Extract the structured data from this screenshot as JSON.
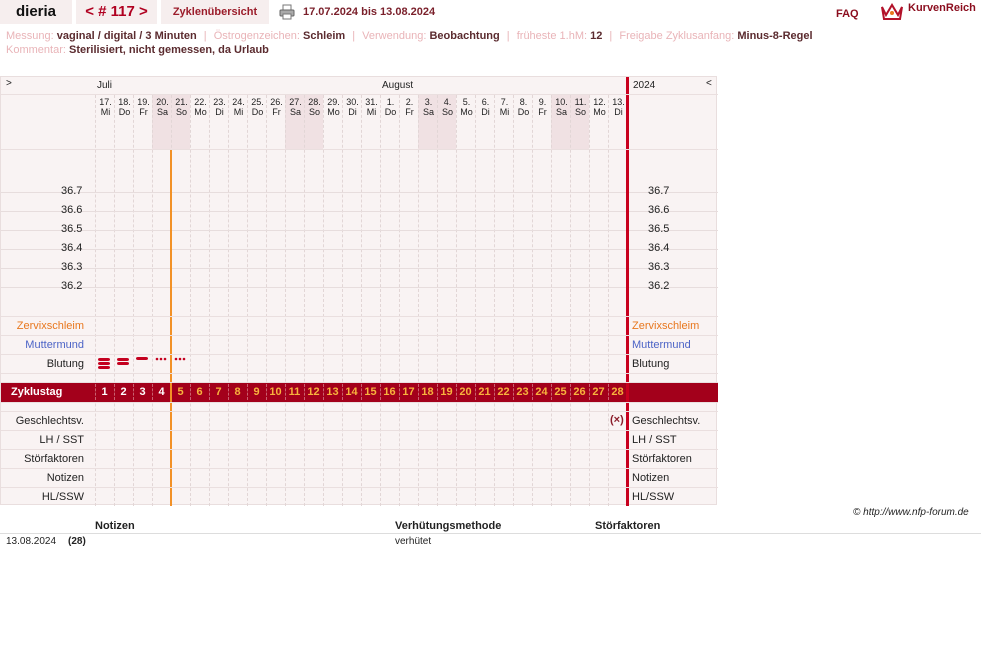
{
  "header": {
    "username": "dieria",
    "cycle_prev": "<",
    "cycle_label": "# 117",
    "cycle_next": ">",
    "overview_tab": "Zyklenübersicht",
    "print_icon": "printer-icon",
    "date_range": "17.07.2024 bis 13.08.2024",
    "faq": "FAQ",
    "logo_text": "KurvenReich",
    "logo_icon": "crown-icon"
  },
  "info": {
    "messung_label": "Messung:",
    "messung_value": "vaginal / digital / 3 Minuten",
    "oestrogen_label": "Östrogenzeichen:",
    "oestrogen_value": "Schleim",
    "verwendung_label": "Verwendung:",
    "verwendung_value": "Beobachtung",
    "hm_label": "früheste 1.hM:",
    "hm_value": "12",
    "freigabe_label": "Freigabe Zyklusanfang:",
    "freigabe_value": "Minus-8-Regel",
    "kommentar_label": "Kommentar:",
    "kommentar_value": "Sterilisiert, nicht gemessen, da Urlaub"
  },
  "chart": {
    "nav_left": ">",
    "nav_right": "<",
    "month_juli": "Juli",
    "month_august": "August",
    "year": "2024",
    "days": [
      {
        "d": "17.",
        "w": "Mi",
        "we": false
      },
      {
        "d": "18.",
        "w": "Do",
        "we": false
      },
      {
        "d": "19.",
        "w": "Fr",
        "we": false
      },
      {
        "d": "20.",
        "w": "Sa",
        "we": true
      },
      {
        "d": "21.",
        "w": "So",
        "we": true
      },
      {
        "d": "22.",
        "w": "Mo",
        "we": false
      },
      {
        "d": "23.",
        "w": "Di",
        "we": false
      },
      {
        "d": "24.",
        "w": "Mi",
        "we": false
      },
      {
        "d": "25.",
        "w": "Do",
        "we": false
      },
      {
        "d": "26.",
        "w": "Fr",
        "we": false
      },
      {
        "d": "27.",
        "w": "Sa",
        "we": true
      },
      {
        "d": "28.",
        "w": "So",
        "we": true
      },
      {
        "d": "29.",
        "w": "Mo",
        "we": false
      },
      {
        "d": "30.",
        "w": "Di",
        "we": false
      },
      {
        "d": "31.",
        "w": "Mi",
        "we": false
      },
      {
        "d": "1.",
        "w": "Do",
        "we": false
      },
      {
        "d": "2.",
        "w": "Fr",
        "we": false
      },
      {
        "d": "3.",
        "w": "Sa",
        "we": true
      },
      {
        "d": "4.",
        "w": "So",
        "we": true
      },
      {
        "d": "5.",
        "w": "Mo",
        "we": false
      },
      {
        "d": "6.",
        "w": "Di",
        "we": false
      },
      {
        "d": "7.",
        "w": "Mi",
        "we": false
      },
      {
        "d": "8.",
        "w": "Do",
        "we": false
      },
      {
        "d": "9.",
        "w": "Fr",
        "we": false
      },
      {
        "d": "10.",
        "w": "Sa",
        "we": true
      },
      {
        "d": "11.",
        "w": "So",
        "we": true
      },
      {
        "d": "12.",
        "w": "Mo",
        "we": false
      },
      {
        "d": "13.",
        "w": "Di",
        "we": false
      }
    ],
    "temps": [
      "36.7",
      "36.6",
      "36.5",
      "36.4",
      "36.3",
      "36.2"
    ],
    "rows": {
      "zervix": "Zervixschleim",
      "muttermund": "Muttermund",
      "blutung": "Blutung",
      "zyklustag": "Zyklustag",
      "geschlechtsv": "Geschlechtsv.",
      "lh": "LH / SST",
      "stoer": "Störfaktoren",
      "notizen": "Notizen",
      "hl": "HL/SSW"
    },
    "cycle_days": [
      "1",
      "2",
      "3",
      "4",
      "5",
      "6",
      "7",
      "8",
      "9",
      "10",
      "11",
      "12",
      "13",
      "14",
      "15",
      "16",
      "17",
      "18",
      "19",
      "20",
      "21",
      "22",
      "23",
      "24",
      "25",
      "26",
      "27",
      "28"
    ],
    "bleeding": [
      "heavy",
      "medium",
      "light",
      "spotting",
      "spotting"
    ],
    "geschlechtsv_marker": "(×)"
  },
  "footer": {
    "copyright": "© http://www.nfp-forum.de",
    "col_notizen": "Notizen",
    "col_verhuetung": "Verhütungsmethode",
    "col_stoer": "Störfaktoren",
    "row_date": "13.08.2024",
    "row_day": "(28)",
    "row_verhuetung": "verhütet"
  }
}
